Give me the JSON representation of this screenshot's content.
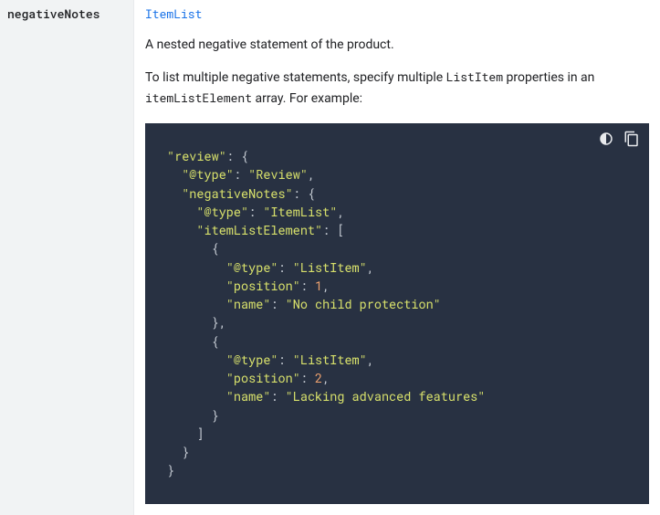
{
  "propertyName": "negativeNotes",
  "typeLink": "ItemList",
  "descLine1": "A nested negative statement of the product.",
  "descLine2a": "To list multiple negative statements, specify multiple ",
  "descLine2inline1": "ListItem",
  "descLine2b": " properties in an ",
  "descLine2inline2": "itemListElement",
  "descLine2c": " array. For example:",
  "code": {
    "k_review": "\"review\"",
    "k_type": "\"@type\"",
    "v_Review": "\"Review\"",
    "k_negativeNotes": "\"negativeNotes\"",
    "v_ItemList": "\"ItemList\"",
    "k_itemListElement": "\"itemListElement\"",
    "v_ListItem": "\"ListItem\"",
    "k_position": "\"position\"",
    "n_1": "1",
    "k_name": "\"name\"",
    "v_name1": "\"No child protection\"",
    "n_2": "2",
    "v_name2": "\"Lacking advanced features\""
  }
}
